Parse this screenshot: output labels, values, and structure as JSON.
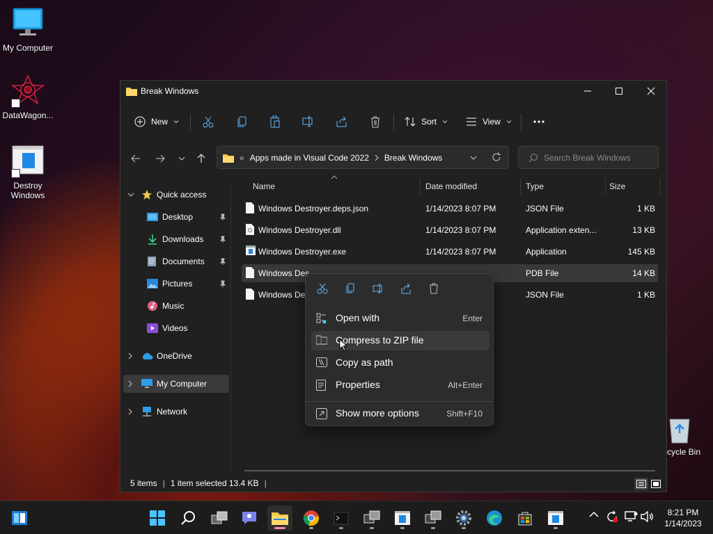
{
  "desktop": {
    "icons": [
      {
        "label": "My Computer"
      },
      {
        "label": "DataWagon..."
      },
      {
        "label": "Destroy Windows"
      },
      {
        "label": "cycle Bin"
      }
    ]
  },
  "window": {
    "title": "Break Windows",
    "toolbar": {
      "new_label": "New",
      "sort_label": "Sort",
      "view_label": "View"
    },
    "address": {
      "crumb_overflow": "«",
      "crumbs": [
        "Apps made in Visual Code 2022",
        "Break Windows"
      ]
    },
    "search": {
      "placeholder": "Search Break Windows"
    },
    "nav": {
      "quick_access": "Quick access",
      "items": [
        {
          "label": "Desktop"
        },
        {
          "label": "Downloads"
        },
        {
          "label": "Documents"
        },
        {
          "label": "Pictures"
        },
        {
          "label": "Music"
        },
        {
          "label": "Videos"
        }
      ],
      "onedrive": "OneDrive",
      "my_computer": "My Computer",
      "network": "Network"
    },
    "columns": {
      "name": "Name",
      "date": "Date modified",
      "type": "Type",
      "size": "Size"
    },
    "files": [
      {
        "name": "Windows Destroyer.deps.json",
        "date": "1/14/2023 8:07 PM",
        "type": "JSON File",
        "size": "1 KB"
      },
      {
        "name": "Windows Destroyer.dll",
        "date": "1/14/2023 8:07 PM",
        "type": "Application exten...",
        "size": "13 KB"
      },
      {
        "name": "Windows Destroyer.exe",
        "date": "1/14/2023 8:07 PM",
        "type": "Application",
        "size": "145 KB"
      },
      {
        "name": "Windows Des",
        "date": "",
        "type": "PDB File",
        "size": "14 KB"
      },
      {
        "name": "Windows De",
        "date": "",
        "type": "JSON File",
        "size": "1 KB"
      }
    ],
    "status": {
      "count": "5 items",
      "selected": "1 item selected  13.4 KB"
    }
  },
  "context_menu": {
    "items": [
      {
        "label": "Open with",
        "shortcut": "Enter"
      },
      {
        "label": "Compress to ZIP file",
        "shortcut": ""
      },
      {
        "label": "Copy as path",
        "shortcut": ""
      },
      {
        "label": "Properties",
        "shortcut": "Alt+Enter"
      },
      {
        "label": "Show more options",
        "shortcut": "Shift+F10"
      }
    ]
  },
  "taskbar": {
    "time": "8:21 PM",
    "date": "1/14/2023"
  },
  "colors": {
    "accent": "#4cc2ff",
    "folder": "#f2c94c",
    "active_indicator": "#ff86b0"
  }
}
